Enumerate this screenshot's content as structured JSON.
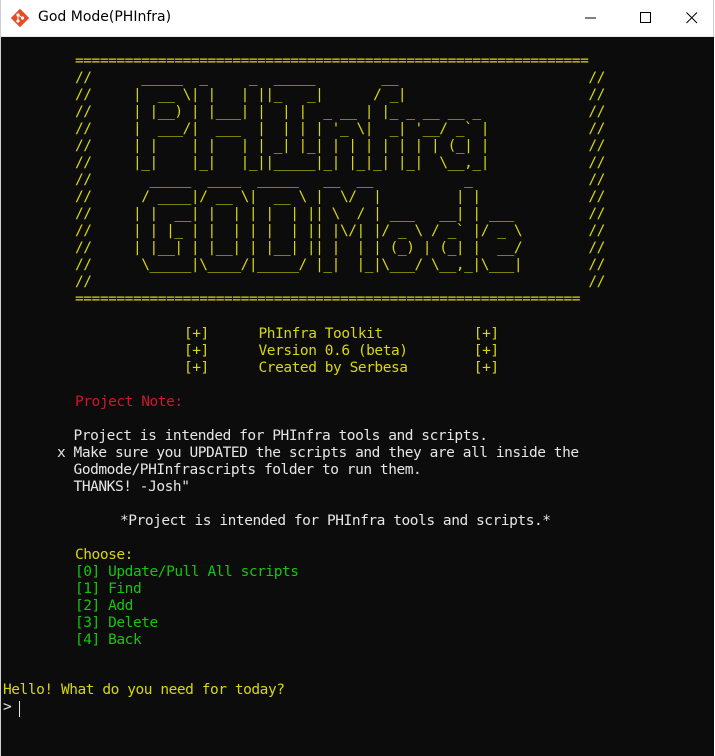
{
  "window": {
    "title": "God Mode(PHInfra)",
    "icon": "git-diamond-icon",
    "accent_icon_color": "#e44d26"
  },
  "banner": {
    "border_top": "==============================================================",
    "art_lines": [
      "//      _____  _     _  _____        __                       //",
      "//     |  __ \\| |   | ||_   _|      / _|                      //",
      "//     | |__) | |___| |  | |  _ __ | |_ _ __ __ _             //",
      "//     |  ___/|  ___  |  | | | '_ \\|  _| '__/ _` |            //",
      "//     | |    | |   | | _| |_| | | | | | | | (_| |            //",
      "//     |_|    |_|   |_||_____|_| |_|_| |_|  \\__,_|            //",
      "//       _____  ____  _____   __  __           _              //",
      "//      / ____|/ __ \\|  __ \\ |  \\/  |         | |             //",
      "//     | |  __| |  | | |  | || \\  / | ___   __| | ___         //",
      "//     | | |_ | |  | | |  | || |\\/| |/ _ \\ / _` |/ _ \\        //",
      "//     | |__| | |__| | |__| || |  | | (_) | (_| |  __/        //",
      "//      \\_____|\\____/|_____/ |_|  |_|\\___/ \\__,_|\\___|        //",
      "//                                                            //"
    ],
    "border_bottom": "============================================================="
  },
  "info": {
    "lines": [
      "[+]      PhInfra Toolkit           [+]",
      "[+]      Version 0.6 (beta)        [+]",
      "[+]      Created by Serbesa        [+]"
    ]
  },
  "note": {
    "heading": "Project Note:",
    "body_line1": "  Project is intended for PHInfra tools and scripts.",
    "body_line2": "x Make sure you UPDATED the scripts and they are all inside the",
    "body_line3": "  Godmode/PHInfrascripts folder to run them.",
    "body_line4": "  THANKS! -Josh\"",
    "emphasis": "*Project is intended for PHInfra tools and scripts.*"
  },
  "menu": {
    "heading": "Choose:",
    "options": [
      "[0] Update/Pull All scripts",
      "[1] Find",
      "[2] Add",
      "[3] Delete",
      "[4] Back"
    ]
  },
  "footer": {
    "question": "Hello! What do you need for today?",
    "prompt": ">"
  },
  "colors": {
    "console_bg": "#0c0c0c",
    "yellow": "#d7d70f",
    "red": "#d3142c",
    "green": "#16c60c",
    "white": "#e6e6e6"
  }
}
